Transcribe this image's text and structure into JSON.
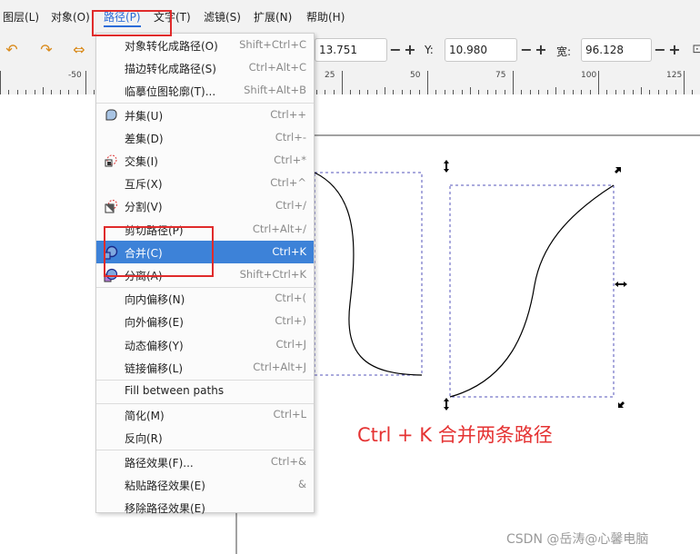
{
  "menubar": {
    "items": [
      "图层(L)",
      "对象(O)",
      "路径(P)",
      "文字(T)",
      "滤镜(S)",
      "扩展(N)",
      "帮助(H)"
    ]
  },
  "toolbar": {
    "x_value": "13.751",
    "y_label": "Y:",
    "y_value": "10.980",
    "w_label": "宽:",
    "w_value": "96.128",
    "minus": "−",
    "plus": "+"
  },
  "ruler": {
    "ticks": [
      "-50",
      "25",
      "50",
      "75",
      "100",
      "125"
    ]
  },
  "path_menu": {
    "groups": [
      [
        {
          "label": "对象转化成路径(O)",
          "shortcut": "Shift+Ctrl+C",
          "icon": ""
        },
        {
          "label": "描边转化成路径(S)",
          "shortcut": "Ctrl+Alt+C",
          "icon": ""
        },
        {
          "label": "临摹位图轮廓(T)...",
          "shortcut": "Shift+Alt+B",
          "icon": ""
        }
      ],
      [
        {
          "label": "并集(U)",
          "shortcut": "Ctrl++",
          "icon": "union-icon"
        },
        {
          "label": "差集(D)",
          "shortcut": "Ctrl+-",
          "icon": ""
        },
        {
          "label": "交集(I)",
          "shortcut": "Ctrl+*",
          "icon": "intersection-icon"
        },
        {
          "label": "互斥(X)",
          "shortcut": "Ctrl+^",
          "icon": ""
        },
        {
          "label": "分割(V)",
          "shortcut": "Ctrl+/",
          "icon": "division-icon"
        },
        {
          "label": "剪切路径(P)",
          "shortcut": "Ctrl+Alt+/",
          "icon": ""
        },
        {
          "label": "合并(C)",
          "shortcut": "Ctrl+K",
          "icon": "combine-icon",
          "highlight": true
        },
        {
          "label": "分离(A)",
          "shortcut": "Shift+Ctrl+K",
          "icon": "break-apart-icon"
        }
      ],
      [
        {
          "label": "向内偏移(N)",
          "shortcut": "Ctrl+(",
          "icon": ""
        },
        {
          "label": "向外偏移(E)",
          "shortcut": "Ctrl+)",
          "icon": ""
        },
        {
          "label": "动态偏移(Y)",
          "shortcut": "Ctrl+J",
          "icon": ""
        },
        {
          "label": "链接偏移(L)",
          "shortcut": "Ctrl+Alt+J",
          "icon": ""
        }
      ],
      [
        {
          "label": "Fill between paths",
          "shortcut": "",
          "icon": ""
        }
      ],
      [
        {
          "label": "简化(M)",
          "shortcut": "Ctrl+L",
          "icon": ""
        },
        {
          "label": "反向(R)",
          "shortcut": "",
          "icon": ""
        }
      ],
      [
        {
          "label": "路径效果(F)...",
          "shortcut": "Ctrl+&",
          "icon": ""
        },
        {
          "label": "粘贴路径效果(E)",
          "shortcut": "&",
          "icon": ""
        },
        {
          "label": "移除路径效果(E)",
          "shortcut": "",
          "icon": ""
        }
      ]
    ]
  },
  "annotation": {
    "caption": "Ctrl + K 合并两条路径"
  },
  "watermark": "CSDN @岳涛@心馨电脑",
  "colors": {
    "highlight": "#3d82d8",
    "annotation_red": "#e02b2b",
    "active_menu": "#2b6cd8"
  }
}
